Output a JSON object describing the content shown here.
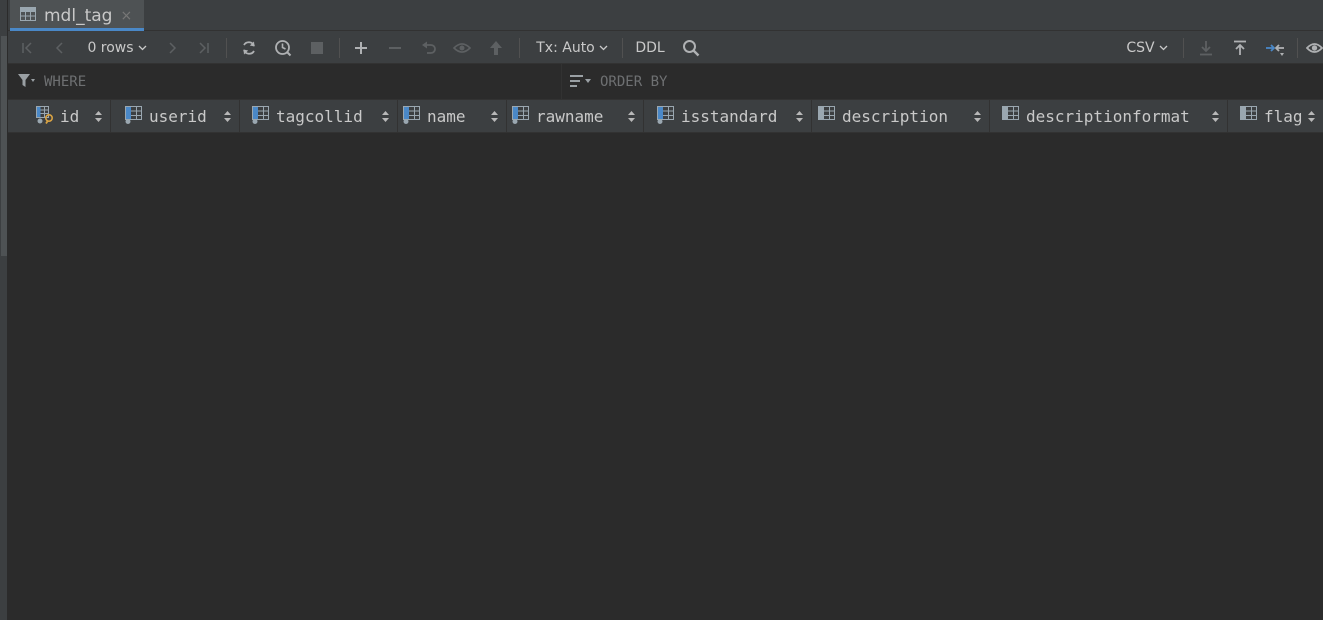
{
  "tab": {
    "title": "mdl_tag",
    "close": "×"
  },
  "toolbar": {
    "rows_label": "0 rows",
    "tx_label": "Tx: Auto",
    "ddl_label": "DDL",
    "export_format": "CSV"
  },
  "filter": {
    "where_placeholder": "WHERE",
    "orderby_placeholder": "ORDER BY"
  },
  "columns": [
    {
      "name": "id",
      "key": true
    },
    {
      "name": "userid"
    },
    {
      "name": "tagcollid"
    },
    {
      "name": "name"
    },
    {
      "name": "rawname"
    },
    {
      "name": "isstandard"
    },
    {
      "name": "description"
    },
    {
      "name": "descriptionformat"
    },
    {
      "name": "flag"
    }
  ],
  "colors": {
    "background": "#2b2b2b",
    "panel": "#3c3f41",
    "tab_active": "#4e5254",
    "accent": "#4a88c7",
    "key_icon": "#d9a343"
  }
}
